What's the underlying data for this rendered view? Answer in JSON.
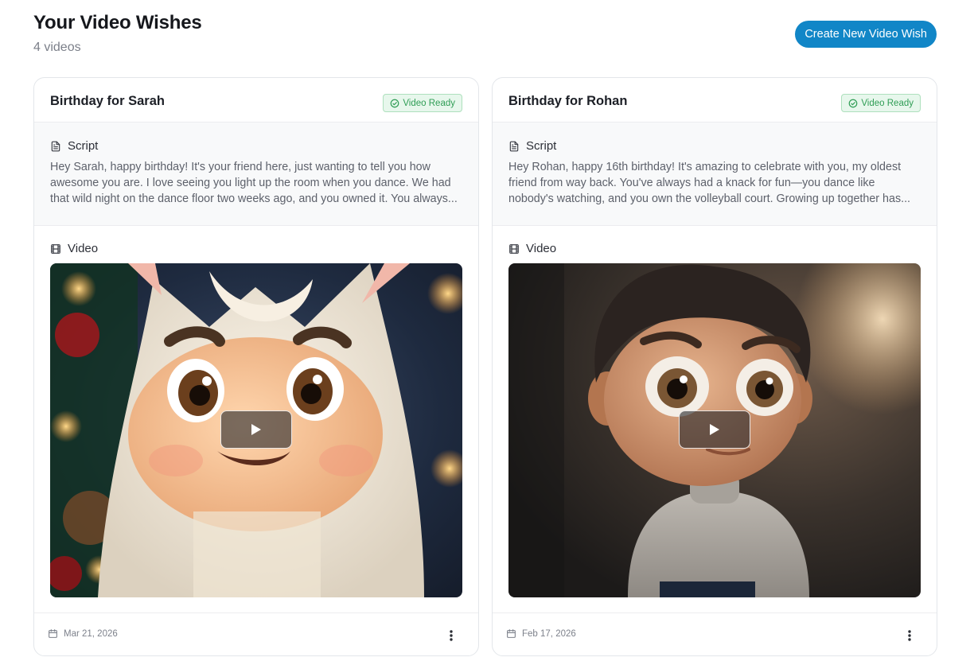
{
  "header": {
    "title": "Your Video Wishes",
    "subtitle": "4 videos",
    "create_button_label": "Create New Video Wish"
  },
  "cards": [
    {
      "title": "Birthday for Sarah",
      "status": "Video Ready",
      "script_label": "Script",
      "script_text": "Hey Sarah, happy birthday! It's your friend here, just wanting to tell you how awesome you are. I love seeing you light up the room when you dance. We had that wild night on the dance floor two weeks ago, and you owned it. You always...",
      "video_label": "Video",
      "date": "Mar 21, 2026"
    },
    {
      "title": "Birthday for Rohan",
      "status": "Video Ready",
      "script_label": "Script",
      "script_text": "Hey Rohan, happy 16th birthday! It's amazing to celebrate with you, my oldest friend from way back. You've always had a knack for fun—you dance like nobody's watching, and you own the volleyball court. Growing up together has...",
      "video_label": "Video",
      "date": "Feb 17, 2026"
    }
  ],
  "icons": {
    "status": "check-circle-icon",
    "script": "document-icon",
    "video": "film-icon",
    "play": "play-icon",
    "date": "calendar-icon",
    "menu": "more-vertical-icon"
  },
  "colors": {
    "accent": "#1186c7",
    "badge_text": "#2f9d55",
    "badge_bg": "#e7f7ec"
  }
}
